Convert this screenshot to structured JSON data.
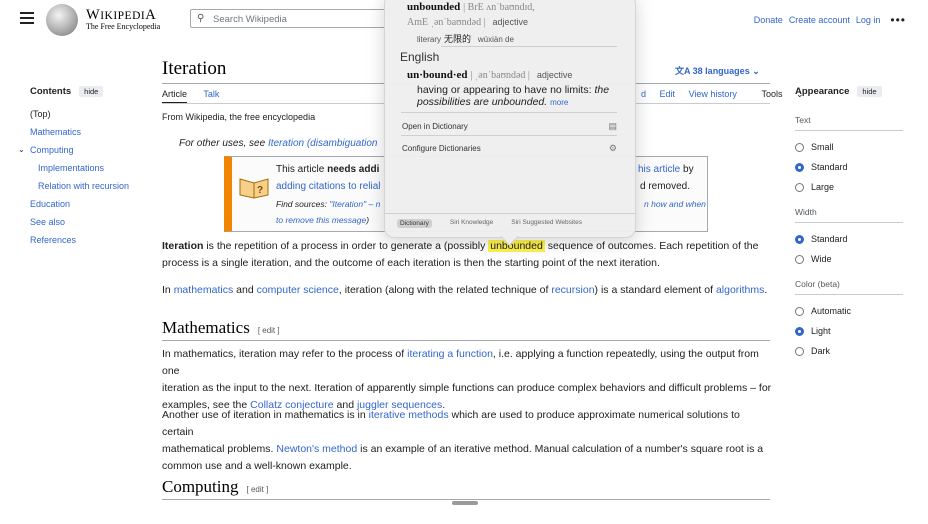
{
  "header": {
    "logo_word": "Wikipedia",
    "logo_tagline": "The Free Encyclopedia",
    "search_placeholder": "Search Wikipedia",
    "links": [
      "Donate",
      "Create account",
      "Log in"
    ],
    "more": "•••"
  },
  "toc": {
    "title": "Contents",
    "hide": "hide",
    "items": [
      "(Top)",
      "Mathematics",
      "Computing",
      "Implementations",
      "Relation with recursion",
      "Education",
      "See also",
      "References"
    ]
  },
  "article": {
    "title": "Iteration",
    "languages": "38 languages",
    "tabs": [
      "Article",
      "Talk"
    ],
    "right_tabs": [
      "d",
      "Edit",
      "View history",
      "Tools"
    ],
    "from": "From Wikipedia, the free encyclopedia",
    "hatnote_prefix": "For other uses, see ",
    "hatnote_link": "Iteration (disambiguation",
    "ambox": {
      "line1_a": "This article ",
      "line1_b": "needs addi",
      "line2": "adding citations to relial",
      "line3_a": "Find sources: ",
      "line3_b": "\"Iteration\" – n",
      "line4": "to remove this message",
      "right1_link": "his article",
      "right1_text": " by",
      "right2": "d removed.",
      "right3": "n how and when"
    },
    "p1_a": "Iteration",
    "p1_b": " is the repetition of a process in order to generate a (possibly ",
    "p1_hl": "unbounded",
    "p1_c": " sequence of outcomes. Each repetition of the",
    "p1_d": "process is a single iteration, and the outcome of each iteration is then the starting point of the next iteration.",
    "p2": [
      "In ",
      "mathematics",
      " and ",
      "computer science",
      ", iteration (along with the related technique of ",
      "recursion",
      ") is a standard element of ",
      "algorithms",
      "."
    ],
    "h_math": "Mathematics",
    "edit": "[ edit ]",
    "m1": [
      "In mathematics, iteration may refer to the process of ",
      "iterating a function",
      ", i.e. applying a function repeatedly, using the output from one"
    ],
    "m1b": "iteration as the input to the next. Iteration of apparently simple functions can produce complex behaviors and difficult problems – for",
    "m1c": [
      "examples, see the ",
      "Collatz conjecture",
      " and ",
      "juggler sequences",
      "."
    ],
    "m2": [
      "Another use of iteration in mathematics is in ",
      "iterative methods",
      " which are used to produce approximate numerical solutions to certain"
    ],
    "m2b": [
      "mathematical problems. ",
      "Newton's method",
      " is an example of an iterative method. Manual calculation of a number's square root is a"
    ],
    "m2c": "common use and a well-known example.",
    "h_comp": "Computing",
    "edit2": "[ edit ]"
  },
  "appearance": {
    "title": "Appearance",
    "hide": "hide",
    "text_label": "Text",
    "text_options": [
      "Small",
      "Standard",
      "Large"
    ],
    "text_selected": "Standard",
    "width_label": "Width",
    "width_options": [
      "Standard",
      "Wide"
    ],
    "width_selected": "Standard",
    "color_label": "Color (beta)",
    "color_options": [
      "Automatic",
      "Light",
      "Dark"
    ],
    "color_selected": "Light"
  },
  "dictionary": {
    "word1": "unbounded",
    "br": "| BrE ʌnˈbaʊndɪd,",
    "am": "AmE ˌənˈbaʊndəd |",
    "pos1": "adjective",
    "literary": "literary",
    "chinese": "无限的",
    "pinyin": "wúxiàn de",
    "english": "English",
    "word2": "un·bound·ed",
    "pron2": "| ˌənˈbaʊndəd |",
    "pos2": "adjective",
    "def": "having or appearing to have no limits:",
    "example": "the possibilities are unbounded.",
    "more": "more",
    "menu": [
      "Open in Dictionary",
      "Configure Dictionaries"
    ],
    "tabs": [
      "Dictionary",
      "Siri Knowledge",
      "Siri Suggested Websites"
    ]
  }
}
